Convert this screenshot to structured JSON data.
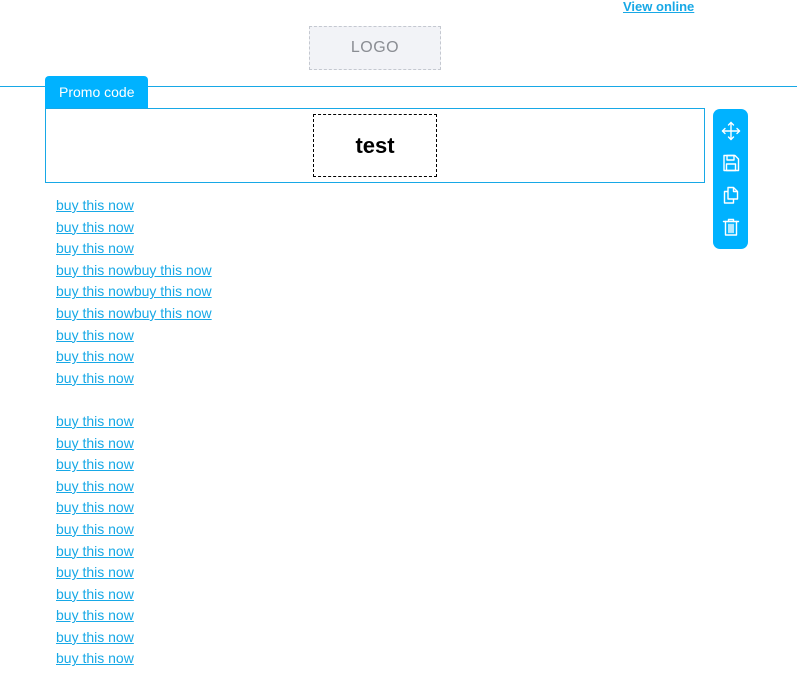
{
  "header": {
    "view_online": "View online",
    "logo_text": "LOGO"
  },
  "promo": {
    "tab_label": "Promo code",
    "code": "test"
  },
  "toolbar": {
    "icons": [
      "move-icon",
      "save-icon",
      "copy-icon",
      "delete-icon"
    ]
  },
  "links": {
    "l0": "buy this now",
    "l1": "buy this now",
    "l2": "buy this now",
    "l3a": "buy this now",
    "l3b": "buy this now",
    "l4a": "buy this now",
    "l4b": "buy this now",
    "l5a": "buy this now",
    "l5b": "buy this now",
    "l6": "buy this now",
    "l7": "buy this now",
    "l8": "buy this now",
    "l10": "buy this now",
    "l11": "buy this now",
    "l12": "buy this now",
    "l13": "buy this now",
    "l14": "buy this now",
    "l15": "buy this now",
    "l16": "buy this now",
    "l17": "buy this now",
    "l18": "buy this now",
    "l19": "buy this now",
    "l20": "buy this now",
    "l21": "buy this now"
  },
  "colors": {
    "accent": "#00b2ff",
    "link": "#17a8e6"
  }
}
